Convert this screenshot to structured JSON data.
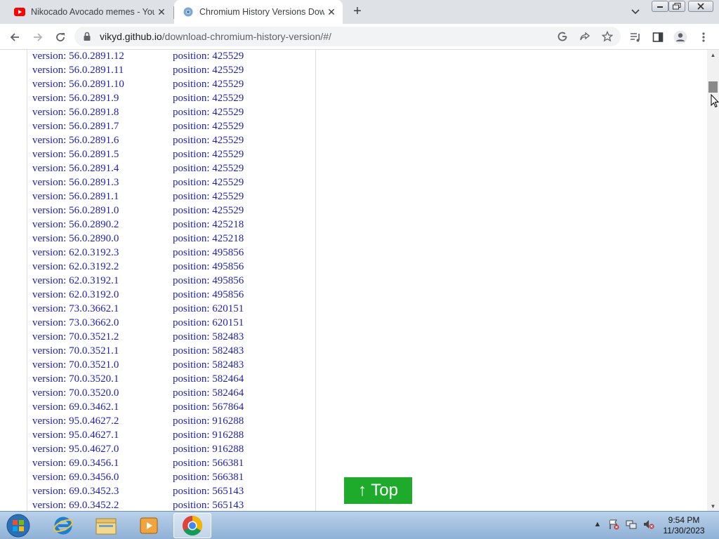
{
  "browser": {
    "tabs": [
      {
        "title": "Nikocado Avocado memes - YouTube",
        "active": false,
        "icon": "youtube-icon"
      },
      {
        "title": "Chromium History Versions Download",
        "active": true,
        "icon": "chromium-icon"
      }
    ],
    "address": {
      "domain": "vikyd.github.io",
      "path": "/download-chromium-history-version/#/"
    }
  },
  "versions": [
    {
      "version": "version: 56.0.2891.12",
      "position": "position: 425529"
    },
    {
      "version": "version: 56.0.2891.11",
      "position": "position: 425529"
    },
    {
      "version": "version: 56.0.2891.10",
      "position": "position: 425529"
    },
    {
      "version": "version: 56.0.2891.9",
      "position": "position: 425529"
    },
    {
      "version": "version: 56.0.2891.8",
      "position": "position: 425529"
    },
    {
      "version": "version: 56.0.2891.7",
      "position": "position: 425529"
    },
    {
      "version": "version: 56.0.2891.6",
      "position": "position: 425529"
    },
    {
      "version": "version: 56.0.2891.5",
      "position": "position: 425529"
    },
    {
      "version": "version: 56.0.2891.4",
      "position": "position: 425529"
    },
    {
      "version": "version: 56.0.2891.3",
      "position": "position: 425529"
    },
    {
      "version": "version: 56.0.2891.1",
      "position": "position: 425529"
    },
    {
      "version": "version: 56.0.2891.0",
      "position": "position: 425529"
    },
    {
      "version": "version: 56.0.2890.2",
      "position": "position: 425218"
    },
    {
      "version": "version: 56.0.2890.0",
      "position": "position: 425218"
    },
    {
      "version": "version: 62.0.3192.3",
      "position": "position: 495856"
    },
    {
      "version": "version: 62.0.3192.2",
      "position": "position: 495856"
    },
    {
      "version": "version: 62.0.3192.1",
      "position": "position: 495856"
    },
    {
      "version": "version: 62.0.3192.0",
      "position": "position: 495856"
    },
    {
      "version": "version: 73.0.3662.1",
      "position": "position: 620151"
    },
    {
      "version": "version: 73.0.3662.0",
      "position": "position: 620151"
    },
    {
      "version": "version: 70.0.3521.2",
      "position": "position: 582483"
    },
    {
      "version": "version: 70.0.3521.1",
      "position": "position: 582483"
    },
    {
      "version": "version: 70.0.3521.0",
      "position": "position: 582483"
    },
    {
      "version": "version: 70.0.3520.1",
      "position": "position: 582464"
    },
    {
      "version": "version: 70.0.3520.0",
      "position": "position: 582464"
    },
    {
      "version": "version: 69.0.3462.1",
      "position": "position: 567864"
    },
    {
      "version": "version: 95.0.4627.2",
      "position": "position: 916288"
    },
    {
      "version": "version: 95.0.4627.1",
      "position": "position: 916288"
    },
    {
      "version": "version: 95.0.4627.0",
      "position": "position: 916288"
    },
    {
      "version": "version: 69.0.3456.1",
      "position": "position: 566381"
    },
    {
      "version": "version: 69.0.3456.0",
      "position": "position: 566381"
    },
    {
      "version": "version: 69.0.3452.3",
      "position": "position: 565143"
    },
    {
      "version": "version: 69.0.3452.2",
      "position": "position: 565143"
    }
  ],
  "top_button": {
    "label": "↑ Top",
    "color": "#1eab2c"
  },
  "taskbar": {
    "apps": [
      "internet-explorer-icon",
      "file-explorer-icon",
      "media-player-icon",
      "chrome-icon"
    ],
    "time": "9:54 PM",
    "date": "11/30/2023"
  }
}
